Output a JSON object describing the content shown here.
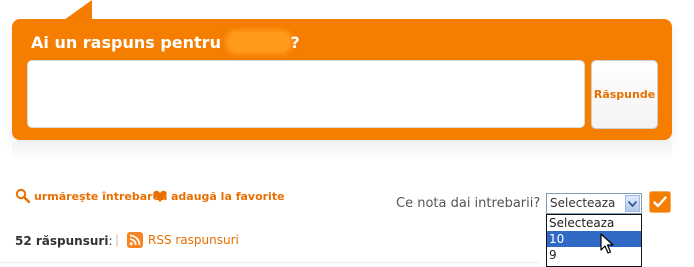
{
  "answer_box": {
    "title_prefix": "Ai un raspuns pentru ",
    "title_suffix": "?",
    "submit_label": "Răspunde"
  },
  "actions": {
    "follow_label": "urmăreşte întrebarea",
    "favorite_label": "adaugă la favorite"
  },
  "vote": {
    "label": "Ce nota dai intrebarii?",
    "selected_value": "Selecteaza",
    "options": [
      "Selecteaza",
      "10",
      "9"
    ],
    "highlighted_option": "10"
  },
  "answers": {
    "count_label": "52 răspunsuri",
    "count_colon": ":",
    "rss_label": "RSS raspunsuri"
  },
  "colors": {
    "accent": "#f57d00",
    "link": "#e86f00",
    "selection": "#316ac5"
  }
}
